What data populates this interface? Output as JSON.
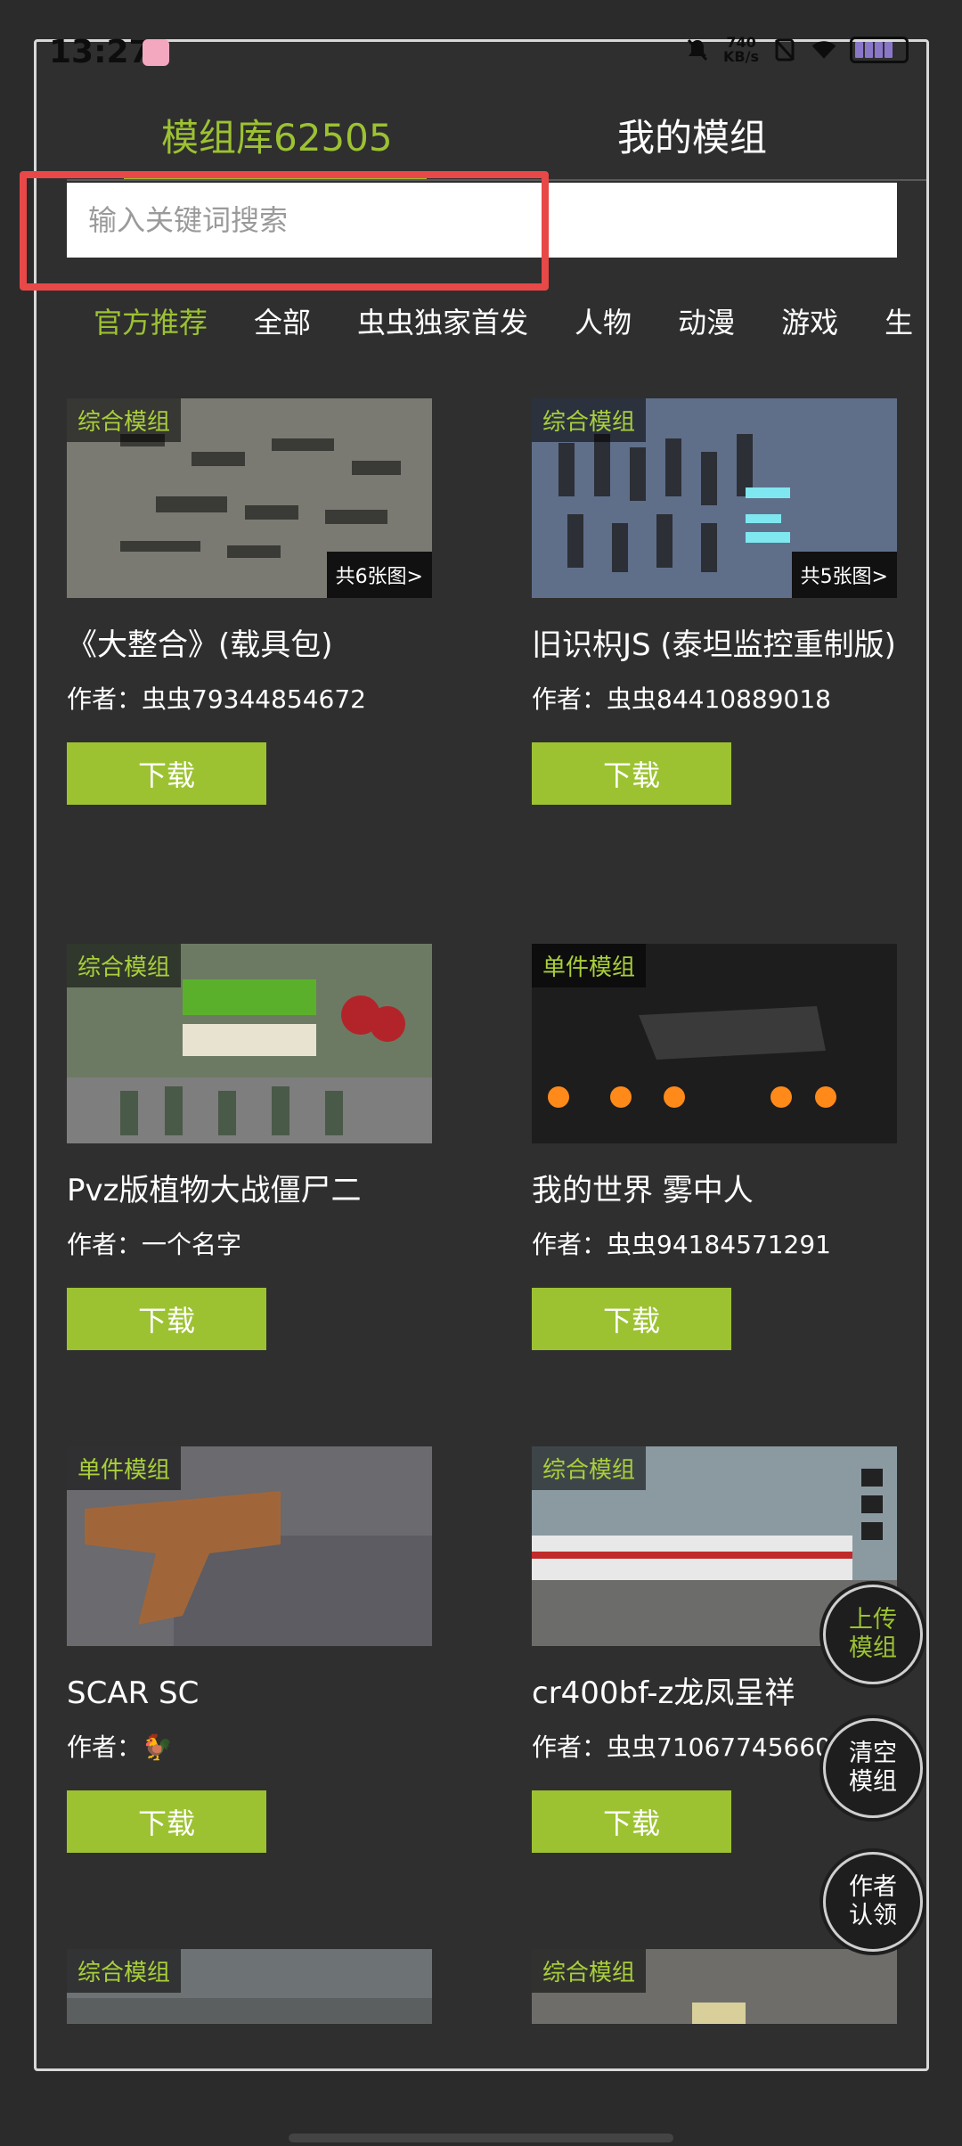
{
  "status": {
    "time": "13:27",
    "speed_top": "740",
    "speed_bottom": "KB/s"
  },
  "tabs": [
    {
      "label": "模组库62505"
    },
    {
      "label": "我的模组"
    }
  ],
  "search": {
    "placeholder": "输入关键词搜索"
  },
  "categories": [
    {
      "label": "官方推荐"
    },
    {
      "label": "全部"
    },
    {
      "label": "虫虫独家首发"
    },
    {
      "label": "人物"
    },
    {
      "label": "动漫"
    },
    {
      "label": "游戏"
    },
    {
      "label": "生"
    }
  ],
  "mods": [
    {
      "tag": "综合模组",
      "count": "共6张图>",
      "title": "《大整合》(载具包)",
      "author": "作者：虫虫79344854672",
      "download": "下载",
      "thumb_color": "#7a7a72"
    },
    {
      "tag": "综合模组",
      "count": "共5张图>",
      "title": "旧识枳JS (泰坦监控重制版)",
      "author": "作者：虫虫84410889018",
      "download": "下载",
      "thumb_color": "#5f6f8a"
    },
    {
      "tag": "综合模组",
      "count": "",
      "title": "Pvz版植物大战僵尸二",
      "author": "作者：一个名字",
      "download": "下载",
      "thumb_color": "#6c7a63"
    },
    {
      "tag": "单件模组",
      "count": "",
      "title": "我的世界 雾中人",
      "author": "作者：虫虫94184571291",
      "download": "下载",
      "thumb_color": "#1d1d1d"
    },
    {
      "tag": "单件模组",
      "count": "",
      "title": "SCAR SC",
      "author": "作者：🐓",
      "download": "下载",
      "thumb_color": "#6a6a6f"
    },
    {
      "tag": "综合模组",
      "count": "",
      "title": "cr400bf-z龙凤呈祥",
      "author": "作者：虫虫71067745660",
      "download": "下载",
      "thumb_color": "#7c8b90"
    },
    {
      "tag": "综合模组",
      "count": "",
      "title": "",
      "author": "",
      "download": "",
      "thumb_color": "#6d7274"
    },
    {
      "tag": "综合模组",
      "count": "",
      "title": "",
      "author": "",
      "download": "",
      "thumb_color": "#6e6d6a"
    }
  ],
  "fabs": {
    "upload": "上传\n模组",
    "clear": "清空\n模组",
    "claim": "作者\n认领"
  },
  "colors": {
    "accent": "#9cc232",
    "background": "#2f2f2f",
    "highlight": "#e84848"
  }
}
